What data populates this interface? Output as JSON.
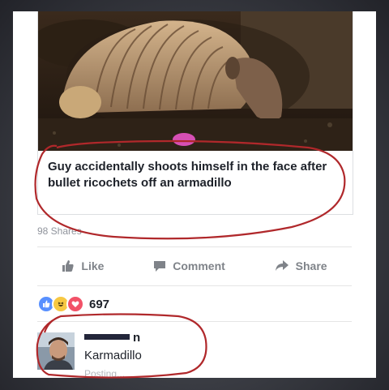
{
  "article": {
    "headline": "Guy accidentally shoots himself in the face after bullet ricochets off an armadillo",
    "image_subject": "armadillo"
  },
  "post": {
    "shares": "98 Shares",
    "like_label": "Like",
    "comment_label": "Comment",
    "share_label": "Share"
  },
  "reactions": {
    "types": [
      "like",
      "haha",
      "love"
    ],
    "count": "697"
  },
  "comment": {
    "name_partial": "n",
    "text": "Karmadillo",
    "status": "Posting..."
  },
  "colors": {
    "annotation": "#b0282b",
    "action_gray": "#7f8389",
    "like_blue": "#5890ff",
    "haha_yellow": "#f7c843",
    "love_red": "#f25268"
  }
}
